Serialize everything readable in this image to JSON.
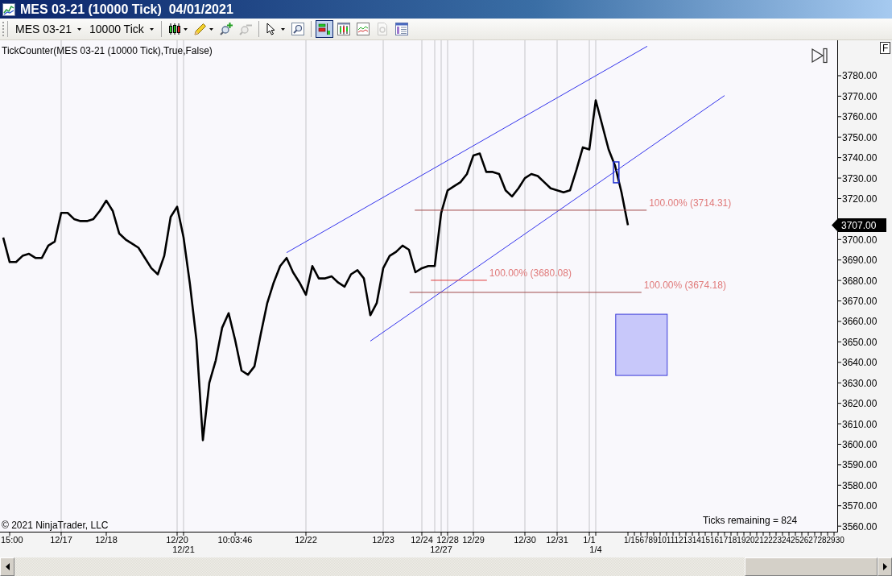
{
  "window": {
    "title": "MES 03-21 (10000 Tick)  04/01/2021"
  },
  "toolbar": {
    "instrument": "MES 03-21",
    "interval": "10000 Tick",
    "groups": [
      [
        {
          "kind": "bar-style",
          "dropdown": true,
          "disabled": false,
          "selected": false
        },
        {
          "kind": "drawing",
          "dropdown": true,
          "disabled": false,
          "selected": false
        },
        {
          "kind": "zoom-in",
          "dropdown": false,
          "disabled": false,
          "selected": false
        },
        {
          "kind": "zoom-out",
          "dropdown": false,
          "disabled": true,
          "selected": false
        }
      ],
      [
        {
          "kind": "pointer",
          "dropdown": true,
          "disabled": false,
          "selected": false
        },
        {
          "kind": "magnify",
          "dropdown": false,
          "disabled": false,
          "selected": false
        }
      ],
      [
        {
          "kind": "data-box",
          "dropdown": false,
          "disabled": false,
          "selected": true
        },
        {
          "kind": "chart-window",
          "dropdown": false,
          "disabled": false,
          "selected": false
        },
        {
          "kind": "indicators",
          "dropdown": false,
          "disabled": false,
          "selected": false
        },
        {
          "kind": "strategies",
          "dropdown": false,
          "disabled": true,
          "selected": false
        },
        {
          "kind": "properties",
          "dropdown": false,
          "disabled": false,
          "selected": false
        }
      ]
    ]
  },
  "chart": {
    "indicator_label": "TickCounter(MES 03-21 (10000 Tick),True,False)",
    "corner_button": "F",
    "copyright": "© 2021 NinjaTrader, LLC",
    "ticks_remaining": "Ticks remaining = 824",
    "last_price_label": "3707.00",
    "chart_data": {
      "type": "line",
      "categories": [
        null,
        "15:00",
        null,
        null,
        null,
        null,
        null,
        null,
        null,
        "12/17",
        null,
        null,
        null,
        null,
        null,
        null,
        "12/18",
        null,
        null,
        null,
        null,
        null,
        null,
        null,
        null,
        null,
        null,
        "12/20",
        "12/21",
        null,
        null,
        null,
        null,
        null,
        null,
        null,
        "10:03:46",
        null,
        null,
        null,
        null,
        null,
        null,
        null,
        null,
        null,
        null,
        "12/22",
        null,
        null,
        null,
        null,
        null,
        null,
        null,
        null,
        null,
        null,
        null,
        "12/23",
        null,
        null,
        null,
        null,
        null,
        "12/24",
        null,
        null,
        "12/27",
        "12/28",
        null,
        null,
        null,
        "12/29",
        null,
        null,
        null,
        null,
        null,
        null,
        null,
        "12/30",
        null,
        null,
        null,
        null,
        "12/31",
        null,
        null,
        null,
        null,
        "1/1",
        "1/4",
        null,
        null,
        null,
        null,
        null,
        null,
        null,
        null,
        null,
        null,
        null,
        null,
        null,
        null,
        null,
        null,
        null,
        null,
        null,
        null,
        null,
        null,
        null,
        null,
        null,
        null,
        null,
        null,
        null,
        null,
        null,
        null,
        null,
        null,
        null,
        null,
        null
      ],
      "series": [
        {
          "color": "#000000",
          "values": [
            3701,
            3689,
            3689,
            3692,
            3693,
            3691,
            3691,
            3697,
            3699,
            3713,
            3713,
            3710,
            3709,
            3709,
            3710,
            3714,
            3719,
            3714,
            3703,
            3700,
            3698,
            3696,
            3691,
            3686,
            3683,
            3692,
            3711,
            3716,
            3701,
            3678,
            3651,
            3602,
            3630,
            3641,
            3657,
            3664,
            3651,
            3636,
            3634,
            3638,
            3654,
            3669,
            3679,
            3687,
            3691,
            3684,
            3679,
            3673,
            3687,
            3681,
            3681,
            3682,
            3679,
            3677,
            3683,
            3685,
            3681,
            3663,
            3669,
            3686,
            3692,
            3694,
            3697,
            3695,
            3684,
            3686,
            3687,
            3687,
            3713,
            3724,
            3726,
            3728,
            3732,
            3741,
            3742,
            3733,
            3733,
            3732,
            3724,
            3721,
            3725,
            3730,
            3732,
            3731,
            3728,
            3725,
            3724,
            3723,
            3724,
            3734,
            3745,
            3744,
            3768,
            3756,
            3744,
            3736,
            3723,
            3707,
            null,
            null,
            null,
            null,
            null,
            null,
            null,
            null,
            null,
            null,
            null,
            null,
            null,
            null,
            null,
            null,
            null,
            null,
            null,
            null,
            null,
            null,
            null,
            null,
            null,
            null,
            null,
            null,
            null,
            null,
            null,
            null
          ]
        },
        {
          "color": "#3434ec",
          "values": [
            null,
            null,
            null,
            null,
            null,
            null,
            null,
            null,
            null,
            null,
            null,
            null,
            null,
            null,
            null,
            null,
            null,
            null,
            null,
            null,
            null,
            null,
            null,
            null,
            null,
            null,
            null,
            null,
            null,
            null,
            null,
            null,
            null,
            null,
            null,
            null,
            null,
            null,
            null,
            null,
            null,
            null,
            null,
            null,
            3693.6,
            null,
            null,
            null,
            null,
            null,
            null,
            null,
            null,
            null,
            null,
            null,
            null,
            null,
            null,
            null,
            null,
            null,
            null,
            null,
            null,
            null,
            null,
            null,
            null,
            null,
            null,
            null,
            null,
            null,
            null,
            null,
            null,
            null,
            null,
            null,
            null,
            null,
            null,
            null,
            null,
            null,
            null,
            null,
            null,
            null,
            null,
            null,
            null,
            null,
            null,
            null,
            null,
            null,
            null,
            null,
            3794.4,
            null,
            null,
            null,
            null,
            null,
            null,
            null,
            null,
            null,
            null,
            null,
            null,
            null,
            null,
            null,
            null,
            null,
            null,
            null,
            null,
            null,
            null,
            null,
            null,
            null,
            null,
            null,
            null,
            null
          ]
        },
        {
          "color": "#3434ec",
          "values": [
            null,
            null,
            null,
            null,
            null,
            null,
            null,
            null,
            null,
            null,
            null,
            null,
            null,
            null,
            null,
            null,
            null,
            null,
            null,
            null,
            null,
            null,
            null,
            null,
            null,
            null,
            null,
            null,
            null,
            null,
            null,
            null,
            null,
            null,
            null,
            null,
            null,
            null,
            null,
            null,
            null,
            null,
            null,
            null,
            null,
            null,
            null,
            null,
            null,
            null,
            null,
            null,
            null,
            null,
            null,
            null,
            null,
            3650.4,
            null,
            null,
            null,
            null,
            null,
            null,
            null,
            null,
            null,
            null,
            null,
            null,
            null,
            null,
            null,
            null,
            null,
            null,
            null,
            null,
            null,
            null,
            null,
            null,
            null,
            null,
            null,
            null,
            null,
            null,
            null,
            null,
            null,
            null,
            null,
            null,
            null,
            null,
            null,
            null,
            null,
            null,
            null,
            null,
            null,
            null,
            null,
            null,
            null,
            null,
            null,
            null,
            null,
            null,
            3770.3,
            null,
            null,
            null,
            null,
            null,
            null,
            null,
            null,
            null,
            null,
            null,
            null,
            null,
            null,
            null,
            null,
            null
          ]
        }
      ],
      "ylim": [
        3557.3,
        3797.3
      ],
      "yticks": [
        {
          "value": 3780,
          "label": "3780.00"
        },
        {
          "value": 3770,
          "label": "3770.00"
        },
        {
          "value": 3760,
          "label": "3760.00"
        },
        {
          "value": 3750,
          "label": "3750.00"
        },
        {
          "value": 3740,
          "label": "3740.00"
        },
        {
          "value": 3730,
          "label": "3730.00"
        },
        {
          "value": 3720,
          "label": "3720.00"
        },
        {
          "value": 3700,
          "label": "3700.00"
        },
        {
          "value": 3690,
          "label": "3690.00"
        },
        {
          "value": 3680,
          "label": "3680.00"
        },
        {
          "value": 3670,
          "label": "3670.00"
        },
        {
          "value": 3660,
          "label": "3660.00"
        },
        {
          "value": 3650,
          "label": "3650.00"
        },
        {
          "value": 3640,
          "label": "3640.00"
        },
        {
          "value": 3630,
          "label": "3630.00"
        },
        {
          "value": 3620,
          "label": "3620.00"
        },
        {
          "value": 3610,
          "label": "3610.00"
        },
        {
          "value": 3600,
          "label": "3600.00"
        },
        {
          "value": 3590,
          "label": "3590.00"
        },
        {
          "value": 3580,
          "label": "3580.00"
        },
        {
          "value": 3570,
          "label": "3570.00"
        },
        {
          "value": 3560,
          "label": "3560.00"
        }
      ],
      "ref_lines": [
        {
          "axis": "y",
          "value": 3714.31,
          "label": "100.00% (3714.31)",
          "color": "#a04848"
        },
        {
          "axis": "y",
          "value": 3680.08,
          "label": "100.00% (3680.08)",
          "color": "#e03c3c"
        },
        {
          "axis": "y",
          "value": 3674.18,
          "label": "100.00% (3674.18)",
          "color": "#a04848"
        }
      ]
    },
    "crowded_axis_text": "1/156789101112131415161718192021222324252627282930",
    "drawings": [
      {
        "kind": "outline-box"
      },
      {
        "kind": "filled-box"
      }
    ]
  }
}
